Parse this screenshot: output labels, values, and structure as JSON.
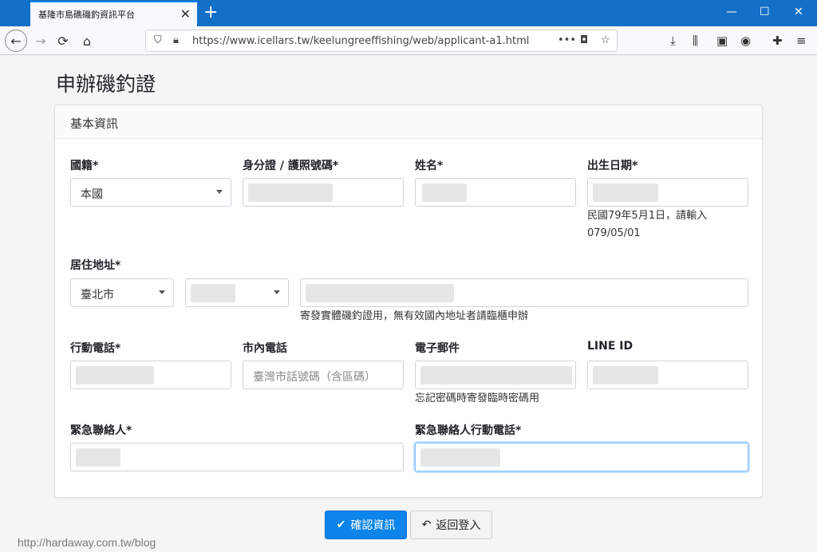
{
  "browser": {
    "tab_title": "基隆市島礁磯釣資訊平台",
    "tab_close": "✕",
    "new_tab": "+",
    "url": "https://www.icellars.tw/keelungreeffishing/web/applicant-a1.html",
    "controls": {
      "minimize": "—",
      "maximize": "☐",
      "close": "✕"
    },
    "icons": [
      "back-icon",
      "forward-icon",
      "reload-icon",
      "home-icon",
      "shield-icon",
      "lock-icon",
      "more-icon",
      "pocket-icon",
      "star-icon",
      "download-icon",
      "library-icon",
      "sidebar-icon",
      "account-icon",
      "extensions-icon",
      "menu-icon"
    ]
  },
  "page": {
    "title": "申辦磯釣證",
    "card_title": "基本資訊",
    "fields": {
      "nationality": {
        "label": "國籍*",
        "value": "本國"
      },
      "id_number": {
        "label": "身分證 / 護照號碼*"
      },
      "name": {
        "label": "姓名*"
      },
      "birthdate": {
        "label": "出生日期*",
        "help": "民國79年5月1日，請輸入079/05/01"
      },
      "address": {
        "label": "居住地址*",
        "city": "臺北市",
        "help": "寄發實體磯釣證用，無有效國內地址者請臨櫃申辦"
      },
      "mobile": {
        "label": "行動電話*"
      },
      "landline": {
        "label": "市內電話",
        "placeholder": "臺灣市話號碼（含區碼）"
      },
      "email": {
        "label": "電子郵件",
        "help": "忘記密碼時寄發臨時密碼用"
      },
      "line_id": {
        "label": "LINE ID"
      },
      "emergency_contact": {
        "label": "緊急聯絡人*"
      },
      "emergency_phone": {
        "label": "緊急聯絡人行動電話*"
      }
    },
    "buttons": {
      "confirm": "確認資訊",
      "back": "返回登入"
    }
  },
  "watermark": "http://hardaway.com.tw/blog",
  "colors": {
    "titlebar": "#1470c7",
    "primary": "#0d84ea",
    "focus": "#80bdff"
  }
}
